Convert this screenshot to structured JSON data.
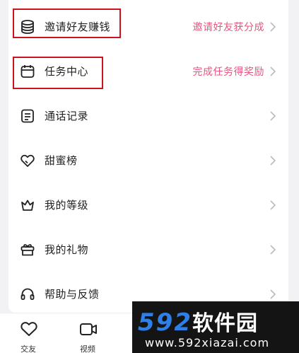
{
  "menu": {
    "items": [
      {
        "label": "邀请好友赚钱",
        "hint": "邀请好友获分成",
        "icon": "coin-stack-icon"
      },
      {
        "label": "任务中心",
        "hint": "完成任务得奖励",
        "icon": "calendar-icon"
      },
      {
        "label": "通话记录",
        "hint": "",
        "icon": "document-icon"
      },
      {
        "label": "甜蜜榜",
        "hint": "",
        "icon": "heart-icon"
      },
      {
        "label": "我的等级",
        "hint": "",
        "icon": "crown-icon"
      },
      {
        "label": "我的礼物",
        "hint": "",
        "icon": "gift-icon"
      },
      {
        "label": "帮助与反馈",
        "hint": "",
        "icon": "headset-icon"
      }
    ]
  },
  "tabbar": {
    "tabs": [
      {
        "label": "交友",
        "icon": "heart-outline-icon"
      },
      {
        "label": "视频",
        "icon": "video-camera-icon"
      }
    ]
  },
  "watermark": {
    "title_digits": "592",
    "title_text": "软件园",
    "url": "www.592xiazai.com"
  },
  "colors": {
    "hint": "#e8557f",
    "highlight": "#c8141e",
    "watermark_blue": "#2f7fe8",
    "watermark_bg": "#141414"
  }
}
